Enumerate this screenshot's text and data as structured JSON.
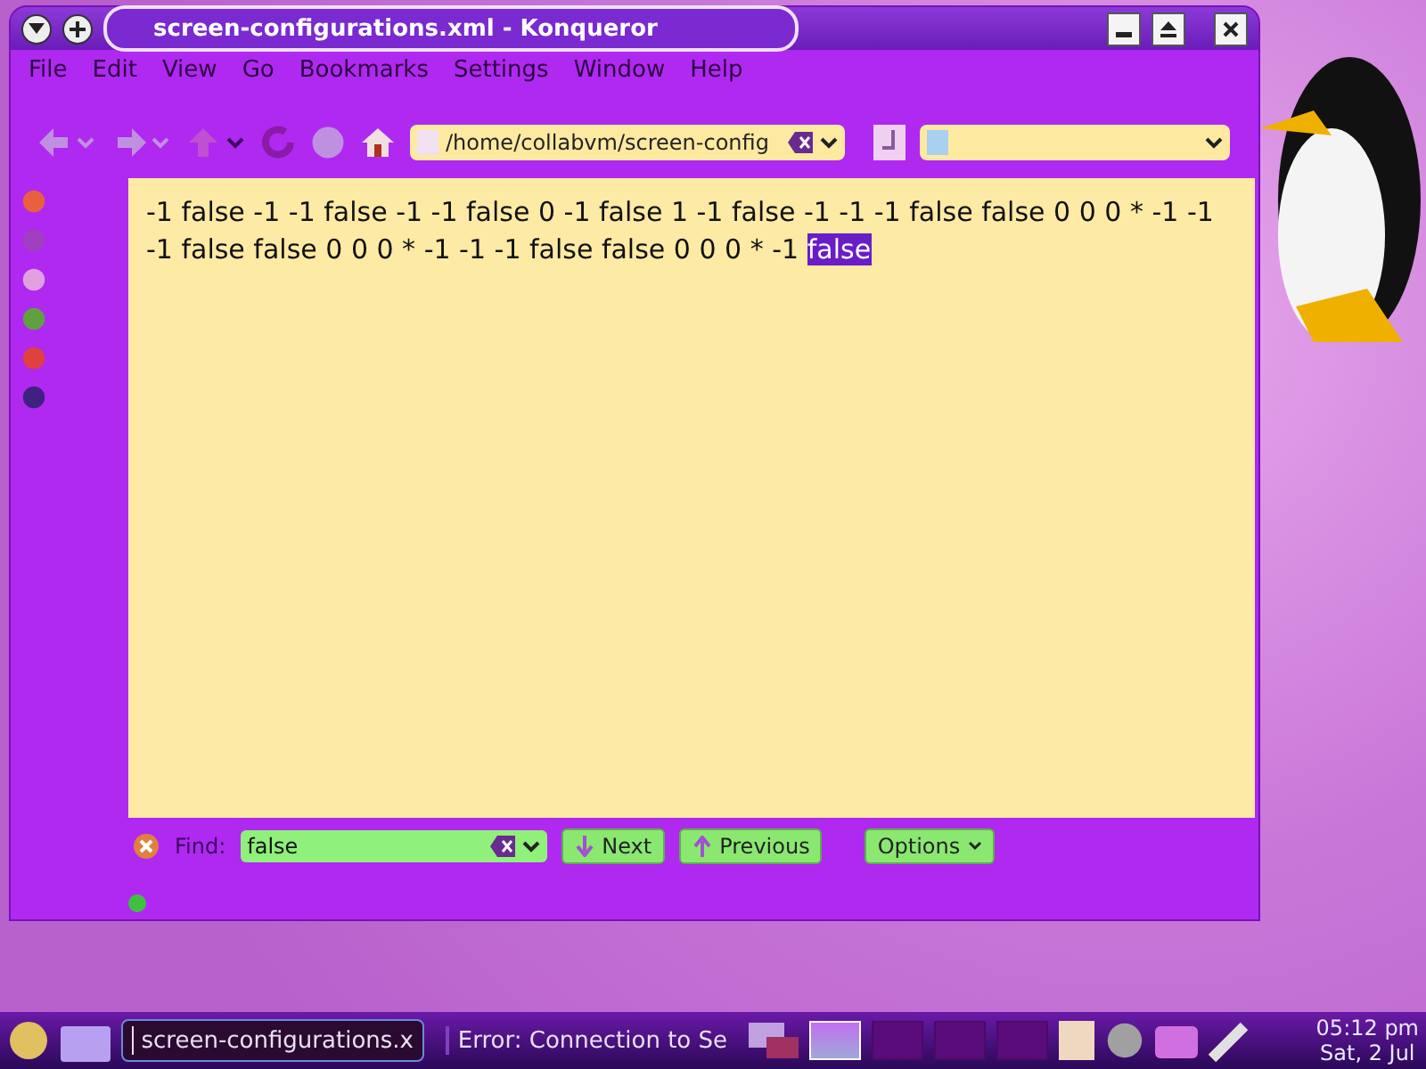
{
  "window": {
    "title": "screen-configurations.xml - Konqueror"
  },
  "menu": [
    "File",
    "Edit",
    "View",
    "Go",
    "Bookmarks",
    "Settings",
    "Window",
    "Help"
  ],
  "location": {
    "value": "/home/collabvm/screen-config"
  },
  "document": {
    "text": "-1 false -1 -1 false -1 -1 false 0 -1 false 1 -1 false -1 -1 -1 false false 0 0 0 * -1 -1 -1 false false 0 0 0 * -1 -1 -1 false false 0 0 0 * -1",
    "match": "false"
  },
  "find_bar": {
    "label": "Find:",
    "value": "false",
    "buttons": [
      {
        "kind": "next",
        "label": "Next"
      },
      {
        "kind": "previous",
        "label": "Previous"
      },
      {
        "kind": "options",
        "label": "Options"
      }
    ]
  },
  "taskbar": {
    "tasks": [
      {
        "label": "screen-configurations.x",
        "selected": true
      },
      {
        "label": "Error: Connection to Se",
        "selected": false
      }
    ],
    "desktops": [
      {
        "selected": true
      },
      {
        "selected": false
      },
      {
        "selected": false
      },
      {
        "selected": false
      }
    ],
    "time": "05:12 pm",
    "date": "Sat, 2 Jul"
  }
}
